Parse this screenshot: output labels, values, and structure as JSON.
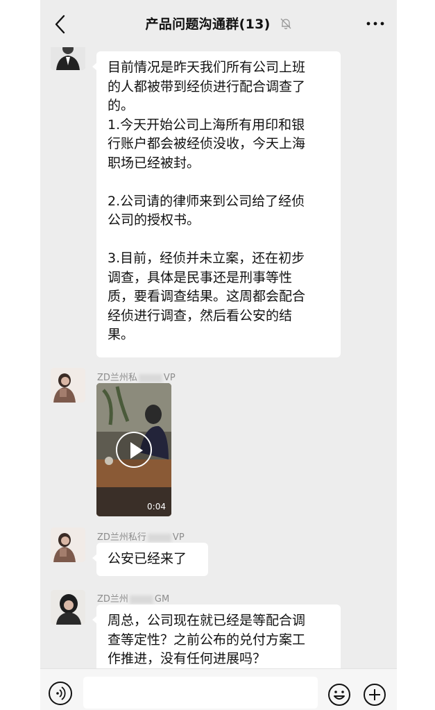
{
  "header": {
    "title": "产品问题沟通群(13)",
    "back_icon": "chevron-left-icon",
    "mute_icon": "bell-off-icon",
    "more_icon": "more-dots-icon"
  },
  "messages": [
    {
      "sender": "",
      "text": "目前情况是昨天我们所有公司上班\n的人都被带到经侦进行配合调查了\n的。\n1.今天开始公司上海所有用印和银\n行账户都会被经侦没收，今天上海\n职场已经被封。\n\n2.公司请的律师来到公司给了经侦\n公司的授权书。\n\n3.目前，经侦并未立案，还在初步\n调查，具体是民事还是刑事等性\n质，要看调查结果。这周都会配合\n经侦进行调查，然后看公安的结\n果。"
    },
    {
      "sender_prefix": "ZD兰州私",
      "sender_suffix": "VP",
      "video_duration": "0:04"
    },
    {
      "sender_prefix": "ZD兰州私行",
      "sender_suffix": "VP",
      "text": "公安已经来了"
    },
    {
      "sender_prefix": "ZD兰州",
      "sender_suffix": "GM",
      "text": "周总，公司现在就已经是等配合调\n查等定性？之前公布的兑付方案工\n作推进，没有任何进展吗？"
    }
  ],
  "inputbar": {
    "placeholder": "",
    "voice_icon": "voice-icon",
    "emoji_icon": "emoji-icon",
    "plus_icon": "plus-icon"
  },
  "colors": {
    "background": "#ededed",
    "bubble": "#ffffff",
    "sender_text": "#8c8c8c"
  }
}
